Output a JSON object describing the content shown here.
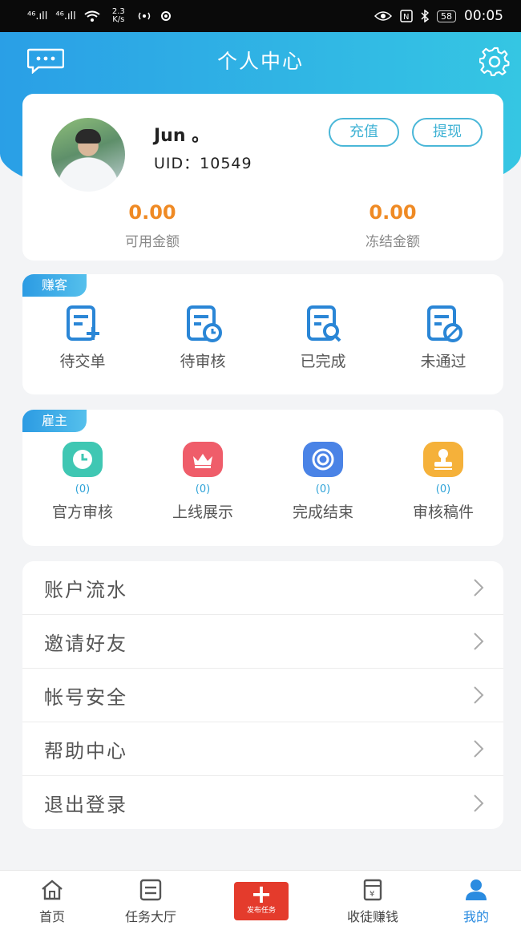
{
  "status_bar": {
    "signal1": "⁴⁶.ıll",
    "signal2": "⁴⁶.ıll",
    "net_speed": "2.3 K/s",
    "battery": "58",
    "time": "00:05"
  },
  "header": {
    "title": "个人中心",
    "message_icon": "chat-bubble-icon",
    "settings_icon": "gear-icon"
  },
  "colors": {
    "header_gradient_start": "#2a9fe6",
    "header_gradient_end": "#35c6e3",
    "balance": "#ef8a24",
    "accent": "#2a8be0",
    "publish": "#e43b2c"
  },
  "profile": {
    "name": "Jun 。",
    "uid_label": "UID：",
    "uid": "10549",
    "recharge_label": "充值",
    "withdraw_label": "提现",
    "available_amount": "0.00",
    "available_label": "可用金额",
    "frozen_amount": "0.00",
    "frozen_label": "冻结金额"
  },
  "zhuanke": {
    "tag": "赚客",
    "items": [
      {
        "label": "待交单",
        "icon": "doc-plus-icon"
      },
      {
        "label": "待审核",
        "icon": "doc-clock-icon"
      },
      {
        "label": "已完成",
        "icon": "doc-search-icon"
      },
      {
        "label": "未通过",
        "icon": "doc-forbidden-icon"
      }
    ]
  },
  "guzhu": {
    "tag": "雇主",
    "items": [
      {
        "label": "官方审核",
        "count": "(0)",
        "icon": "clock-icon",
        "color": "#3fc7b3"
      },
      {
        "label": "上线展示",
        "count": "(0)",
        "icon": "crown-icon",
        "color": "#ef5d6a"
      },
      {
        "label": "完成结束",
        "count": "(0)",
        "icon": "target-icon",
        "color": "#4a83e6"
      },
      {
        "label": "审核稿件",
        "count": "(0)",
        "icon": "stamp-icon",
        "color": "#f5b13a"
      }
    ]
  },
  "menu": [
    {
      "label": "账户流水"
    },
    {
      "label": "邀请好友"
    },
    {
      "label": "帐号安全"
    },
    {
      "label": "帮助中心"
    },
    {
      "label": "退出登录"
    }
  ],
  "tabbar": {
    "home": "首页",
    "tasks": "任务大厅",
    "publish": "发布任务",
    "earn": "收徒赚钱",
    "mine": "我的"
  }
}
